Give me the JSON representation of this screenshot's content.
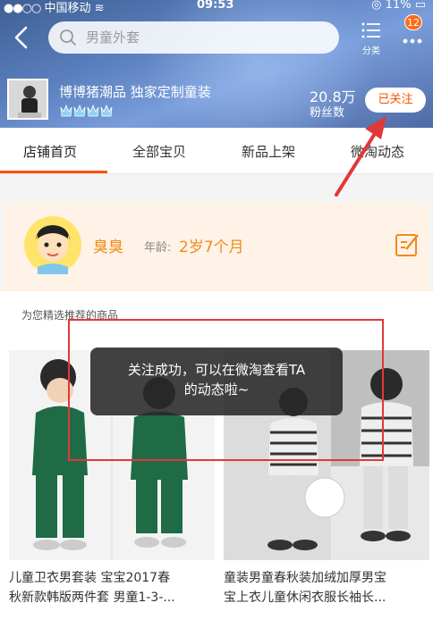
{
  "status_bar": {
    "carrier": "中国移动",
    "time": "09:53",
    "battery": "11%"
  },
  "search": {
    "placeholder": "男童外套"
  },
  "header": {
    "category_label": "分类",
    "badge_count": "12"
  },
  "shop": {
    "name": "博博猪潮品 独家定制童装",
    "fans_count": "20.8万",
    "fans_label": "粉丝数",
    "follow_label": "已关注"
  },
  "tabs": [
    {
      "label": "店铺首页",
      "active": true
    },
    {
      "label": "全部宝贝",
      "active": false
    },
    {
      "label": "新品上架",
      "active": false
    },
    {
      "label": "微淘动态",
      "active": false
    }
  ],
  "profile": {
    "name": "臭臭",
    "age_label": "年龄:",
    "age_value": "2岁7个月"
  },
  "recommend": {
    "title": "为您精选推荐的商品"
  },
  "products": [
    {
      "title_line1": "儿童卫衣男套装 宝宝2017春",
      "title_line2": "秋新款韩版两件套 男童1-3-..."
    },
    {
      "title_line1": "童装男童春秋装加绒加厚男宝",
      "title_line2": "宝上衣儿童休闲衣服长袖长..."
    }
  ],
  "toast": {
    "line1": "关注成功，可以在微淘查看TA",
    "line2": "的动态啦~"
  },
  "colors": {
    "accent": "#ff5000",
    "profile_bg": "#fef3e6",
    "profile_text": "#f08a1c",
    "annotation_red": "#e0393a"
  }
}
